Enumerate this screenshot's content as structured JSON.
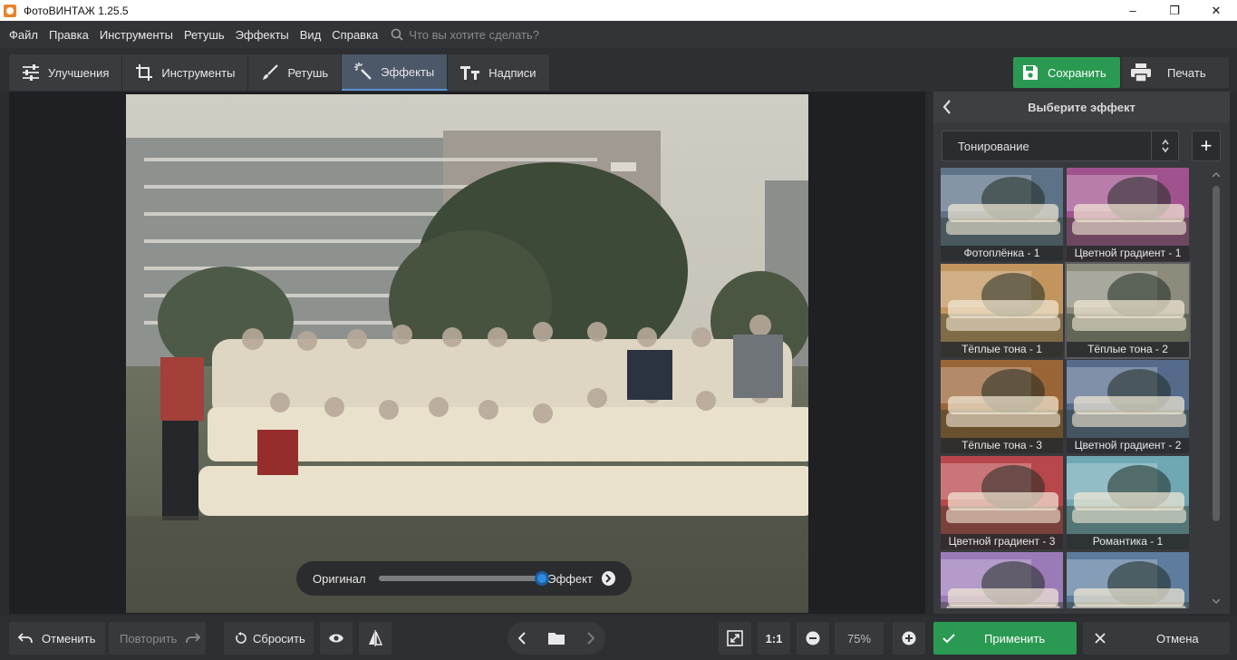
{
  "window": {
    "title": "ФотоВИНТАЖ 1.25.5",
    "controls": [
      "–",
      "❐",
      "✕"
    ]
  },
  "menu": {
    "items": [
      "Файл",
      "Правка",
      "Инструменты",
      "Ретушь",
      "Эффекты",
      "Вид",
      "Справка"
    ],
    "search_placeholder": "Что вы хотите сделать?"
  },
  "tabs": [
    {
      "label": "Улучшения",
      "icon": "sliders-icon",
      "active": false
    },
    {
      "label": "Инструменты",
      "icon": "crop-icon",
      "active": false
    },
    {
      "label": "Ретушь",
      "icon": "brush-icon",
      "active": false
    },
    {
      "label": "Эффекты",
      "icon": "magic-wand-icon",
      "active": true
    },
    {
      "label": "Надписи",
      "icon": "text-icon",
      "active": false
    }
  ],
  "actions": {
    "save_label": "Сохранить",
    "print_label": "Печать"
  },
  "compare": {
    "left_label": "Оригинал",
    "right_label": "Эффект",
    "position": 0.97
  },
  "panel": {
    "title": "Выберите эффект",
    "category": "Тонирование",
    "add_label": "+",
    "effects": [
      {
        "label": "Фотоплёнка - 1",
        "tint": "#5d7287",
        "selected": false
      },
      {
        "label": "Цветной градиент - 1",
        "tint": "#a0528f",
        "selected": false
      },
      {
        "label": "Тёплые тона - 1",
        "tint": "#c2955e",
        "selected": false
      },
      {
        "label": "Тёплые тона - 2",
        "tint": "#8d8b7c",
        "selected": true
      },
      {
        "label": "Тёплые тона - 3",
        "tint": "#9a6536",
        "selected": false
      },
      {
        "label": "Цветной градиент - 2",
        "tint": "#566b8c",
        "selected": false
      },
      {
        "label": "Цветной градиент - 3",
        "tint": "#b8474b",
        "selected": false
      },
      {
        "label": "Романтика - 1",
        "tint": "#6fa7b3",
        "selected": false
      },
      {
        "label": "",
        "tint": "#9b7ab8",
        "selected": false
      },
      {
        "label": "",
        "tint": "#5d7c9e",
        "selected": false
      }
    ]
  },
  "bottom": {
    "undo_label": "Отменить",
    "redo_label": "Повторить",
    "reset_label": "Сбросить",
    "zoom_1to1": "1:1",
    "zoom_value": "75%",
    "apply_label": "Применить",
    "cancel_label": "Отмена"
  },
  "colors": {
    "accent_green": "#2a9a52",
    "accent_blue": "#2e8be0",
    "active_tab": "#4c5868"
  }
}
